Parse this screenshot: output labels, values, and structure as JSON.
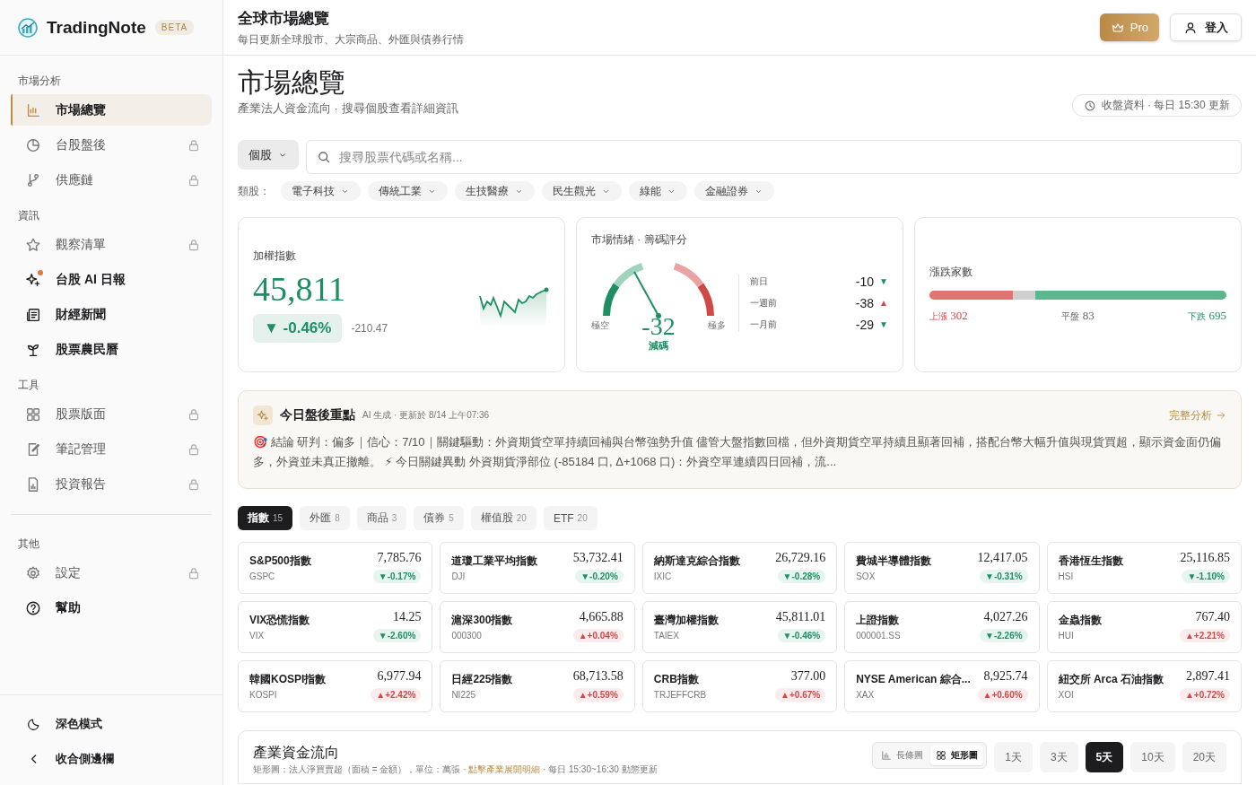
{
  "brand": {
    "name": "TradingNote",
    "badge": "BETA"
  },
  "header": {
    "title": "全球市場總覽",
    "subtitle": "每日更新全球股市、大宗商品、外匯與債券行情",
    "buttons": [
      {
        "kind": "pro",
        "label": "Pro"
      },
      {
        "kind": "login",
        "label": "登入"
      }
    ]
  },
  "sidebar": {
    "sections": [
      {
        "title": "市場分析",
        "items": [
          {
            "label": "市場總覽",
            "selected": true,
            "locked": false,
            "dot": false
          },
          {
            "label": "台股盤後",
            "selected": false,
            "locked": true,
            "dot": false
          },
          {
            "label": "供應鏈",
            "selected": false,
            "locked": true,
            "dot": false
          }
        ]
      },
      {
        "title": "資訊",
        "items": [
          {
            "label": "觀察清單",
            "selected": false,
            "locked": true,
            "dot": false
          },
          {
            "label": "台股 AI 日報",
            "selected": false,
            "locked": false,
            "dot": true
          },
          {
            "label": "財經新聞",
            "selected": false,
            "locked": false,
            "dot": false
          },
          {
            "label": "股票農民曆",
            "selected": false,
            "locked": false,
            "dot": false
          }
        ]
      },
      {
        "title": "工具",
        "items": [
          {
            "label": "股票版面",
            "selected": false,
            "locked": true,
            "dot": false
          },
          {
            "label": "筆記管理",
            "selected": false,
            "locked": true,
            "dot": false
          },
          {
            "label": "投資報告",
            "selected": false,
            "locked": true,
            "dot": false
          }
        ]
      },
      {
        "title": "其他",
        "items": [
          {
            "label": "設定",
            "selected": false,
            "locked": true,
            "dot": false
          },
          {
            "label": "幫助",
            "selected": false,
            "locked": false,
            "dot": false
          }
        ]
      }
    ],
    "footer": [
      "深色模式",
      "收合側邊欄"
    ]
  },
  "page": {
    "title": "市場總覽",
    "subtitle": "產業法人資金流向 · 搜尋個股查看詳細資訊",
    "update_badge": "收盤資料 · 每日 15:30 更新"
  },
  "search": {
    "scope": "個股",
    "placeholder": "搜尋股票代碼或名稱..."
  },
  "sectors": {
    "label": "類股：",
    "items": [
      "電子科技",
      "傳統工業",
      "生技醫療",
      "民生觀光",
      "綠能",
      "金融證券"
    ]
  },
  "index_card": {
    "title": "加權指數",
    "value": "45,811",
    "change": "▼ -0.46%",
    "color": "#1e8f63",
    "points": "-210.47"
  },
  "sentiment_card": {
    "title": "市場情緒 · 籌碼評分",
    "score": "-32",
    "level": 0.34,
    "verdict": "減碼",
    "min_label": "極空",
    "max_label": "極多",
    "history": [
      {
        "label": "前日",
        "value": "-10",
        "arrow": "▼",
        "color": "#1e8f63"
      },
      {
        "label": "一週前",
        "value": "-38",
        "arrow": "▲",
        "color": "#d04848"
      },
      {
        "label": "一月前",
        "value": "-29",
        "arrow": "▼",
        "color": "#1e8f63"
      }
    ]
  },
  "breadth_card": {
    "title": "漲跌家數",
    "groups": [
      {
        "kind": "up",
        "label": "上漲",
        "value": "302"
      },
      {
        "kind": "flat",
        "label": "平盤",
        "value": "83"
      },
      {
        "kind": "down",
        "label": "下跌",
        "value": "695"
      }
    ]
  },
  "highlights": {
    "title": "今日盤後重點",
    "meta": "AI 生成 · 更新於 8/14 上午07:36",
    "link": "完整分析",
    "text": "🎯 結論 研判：偏多｜信心：7/10｜關鍵驅動：外資期貨空單持續回補與台幣強勢升值 儘管大盤指數回檔，但外資期貨空單持續且顯著回補，搭配台幣大幅升值與現貨買超，顯示資金面仍偏多，外資並未真正撤離。 ⚡ 今日關鍵異動 外資期貨淨部位 (-85184 口, Δ+1068 口)：外資空單連續四日回補，流..."
  },
  "tabs": [
    {
      "label": "指數",
      "count": "15",
      "selected": true
    },
    {
      "label": "外匯",
      "count": "8",
      "selected": false
    },
    {
      "label": "商品",
      "count": "3",
      "selected": false
    },
    {
      "label": "債券",
      "count": "5",
      "selected": false
    },
    {
      "label": "權值股",
      "count": "20",
      "selected": false
    },
    {
      "label": "ETF",
      "count": "20",
      "selected": false
    }
  ],
  "quotes": [
    {
      "name": "S&P500指數",
      "code": "GSPC",
      "value": "7,785.76",
      "change": "▼-0.17%",
      "color": "#1e8f63"
    },
    {
      "name": "道瓊工業平均指數",
      "code": "DJI",
      "value": "53,732.41",
      "change": "▼-0.20%",
      "color": "#1e8f63"
    },
    {
      "name": "納斯達克綜合指數",
      "code": "IXIC",
      "value": "26,729.16",
      "change": "▼-0.28%",
      "color": "#1e8f63"
    },
    {
      "name": "費城半導體指數",
      "code": "SOX",
      "value": "12,417.05",
      "change": "▼-0.31%",
      "color": "#1e8f63"
    },
    {
      "name": "香港恆生指數",
      "code": "HSI",
      "value": "25,116.85",
      "change": "▼-1.10%",
      "color": "#1e8f63"
    },
    {
      "name": "VIX恐慌指數",
      "code": "VIX",
      "value": "14.25",
      "change": "▼-2.60%",
      "color": "#1e8f63"
    },
    {
      "name": "滬深300指數",
      "code": "000300",
      "value": "4,665.88",
      "change": "▲+0.04%",
      "color": "#d04848"
    },
    {
      "name": "臺灣加權指數",
      "code": "TAIEX",
      "value": "45,811.01",
      "change": "▼-0.46%",
      "color": "#1e8f63"
    },
    {
      "name": "上證指數",
      "code": "000001.SS",
      "value": "4,027.26",
      "change": "▼-2.26%",
      "color": "#1e8f63"
    },
    {
      "name": "金蟲指數",
      "code": "HUI",
      "value": "767.40",
      "change": "▲+2.21%",
      "color": "#d04848"
    },
    {
      "name": "韓國KOSPI指數",
      "code": "KOSPI",
      "value": "6,977.94",
      "change": "▲+2.42%",
      "color": "#d04848"
    },
    {
      "name": "日經225指數",
      "code": "NI225",
      "value": "68,713.58",
      "change": "▲+0.59%",
      "color": "#d04848"
    },
    {
      "name": "CRB指數",
      "code": "TRJEFFCRB",
      "value": "377.00",
      "change": "▲+0.67%",
      "color": "#d04848"
    },
    {
      "name": "NYSE American 綜合...",
      "code": "XAX",
      "value": "8,925.74",
      "change": "▲+0.60%",
      "color": "#d04848"
    },
    {
      "name": "紐交所 Arca 石油指數",
      "code": "XOI",
      "value": "2,897.41",
      "change": "▲+0.72%",
      "color": "#d04848"
    }
  ],
  "flow_panel": {
    "title": "產業資金流向",
    "subtitle_before": "矩形圖：法人淨買賣超（面積 = 金額），單位：萬張 · ",
    "subtitle_link": "點擊產業展開明細",
    "subtitle_after": " · 每日 15:30~16:30 動態更新",
    "views": [
      {
        "label": "長條圖",
        "selected": false
      },
      {
        "label": "矩形圖",
        "selected": true
      }
    ],
    "ranges": [
      {
        "label": "1天",
        "selected": false
      },
      {
        "label": "3天",
        "selected": false
      },
      {
        "label": "5天",
        "selected": true
      },
      {
        "label": "10天",
        "selected": false
      },
      {
        "label": "20天",
        "selected": false
      }
    ]
  }
}
